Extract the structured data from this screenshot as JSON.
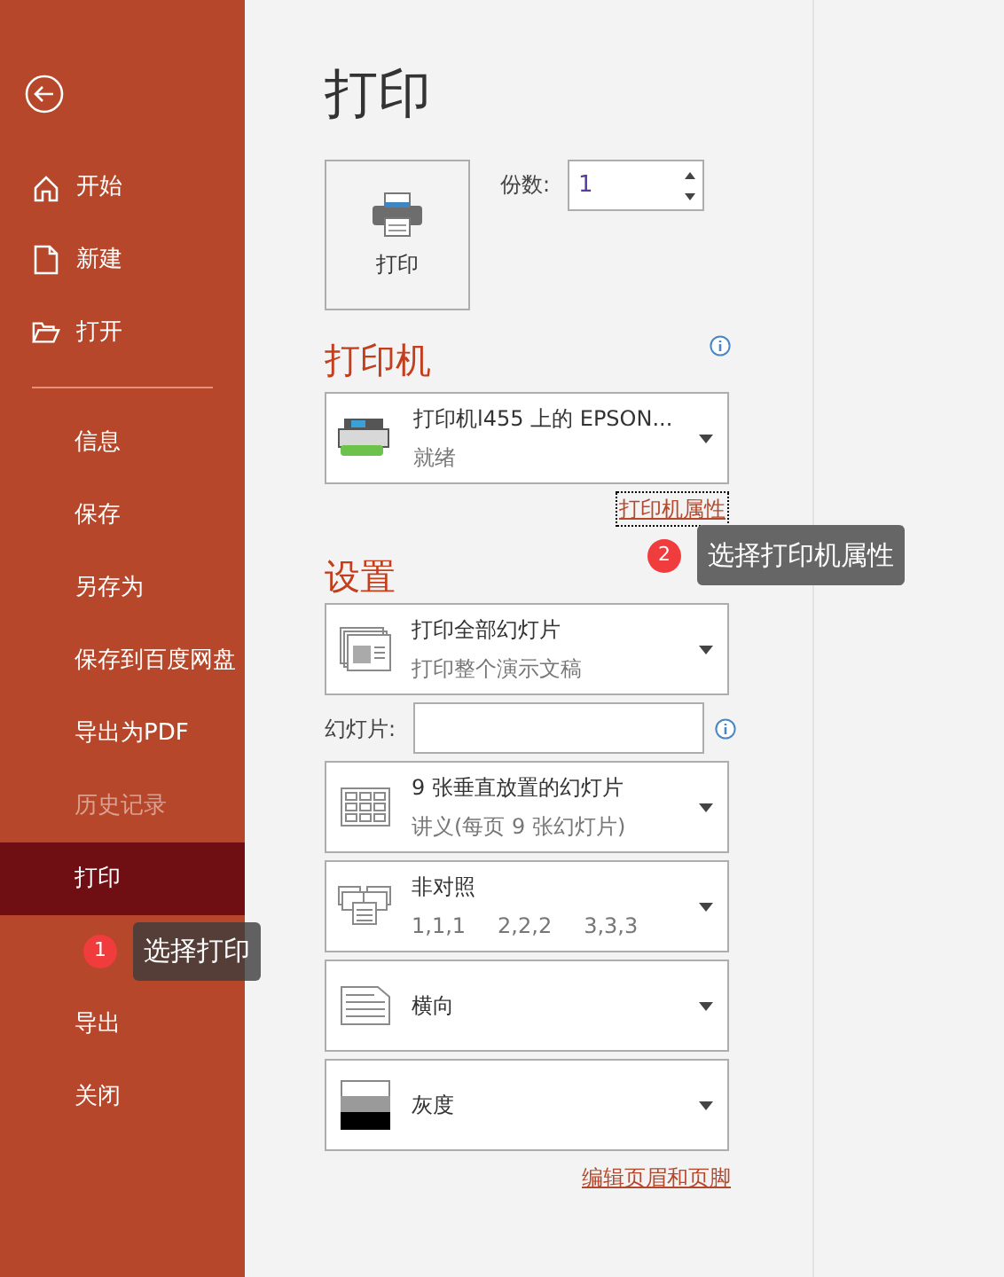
{
  "sidebar": {
    "items": [
      {
        "kind": "item",
        "label": "开始",
        "selected": false,
        "disabled": false
      },
      {
        "kind": "item",
        "label": "新建",
        "selected": false,
        "disabled": false
      },
      {
        "kind": "item",
        "label": "打开",
        "selected": false,
        "disabled": false
      },
      {
        "kind": "divider"
      },
      {
        "kind": "item",
        "label": "信息",
        "selected": false,
        "disabled": false
      },
      {
        "kind": "item",
        "label": "保存",
        "selected": false,
        "disabled": false
      },
      {
        "kind": "item",
        "label": "另存为",
        "selected": false,
        "disabled": false
      },
      {
        "kind": "item",
        "label": "保存到百度网盘",
        "selected": false,
        "disabled": false
      },
      {
        "kind": "item",
        "label": "导出为PDF",
        "selected": false,
        "disabled": false
      },
      {
        "kind": "item",
        "label": "历史记录",
        "selected": false,
        "disabled": true
      },
      {
        "kind": "item",
        "label": "打印",
        "selected": true,
        "disabled": false
      },
      {
        "kind": "callout",
        "number": "1",
        "text": "选择打印"
      },
      {
        "kind": "item",
        "label": "导出",
        "selected": false,
        "disabled": false
      },
      {
        "kind": "item",
        "label": "关闭",
        "selected": false,
        "disabled": false
      }
    ]
  },
  "title": "打印",
  "print_button": "打印",
  "copies": {
    "label": "份数:",
    "value": "1"
  },
  "printer": {
    "heading": "打印机",
    "name": "打印机l455 上的 EPSON...",
    "status": "就绪",
    "link": "打印机属性"
  },
  "settings": {
    "heading": "设置",
    "dropdowns": [
      {
        "kind": "dropdown",
        "title": "打印全部幻灯片",
        "subtitle": [
          "打印整个演示文稿"
        ]
      },
      {
        "kind": "field",
        "label": "幻灯片:"
      },
      {
        "kind": "dropdown",
        "title": "9 张垂直放置的幻灯片",
        "subtitle": [
          "讲义(每页 9 张幻灯片)"
        ]
      },
      {
        "kind": "dropdown",
        "title": "非对照",
        "subtitle": [
          "1,1,1",
          "2,2,2",
          "3,3,3"
        ]
      },
      {
        "kind": "dropdown",
        "title": "横向"
      },
      {
        "kind": "dropdown",
        "title": "灰度"
      }
    ],
    "link": "编辑页眉和页脚"
  },
  "callout": {
    "number": "2",
    "text": "选择打印机属性"
  }
}
